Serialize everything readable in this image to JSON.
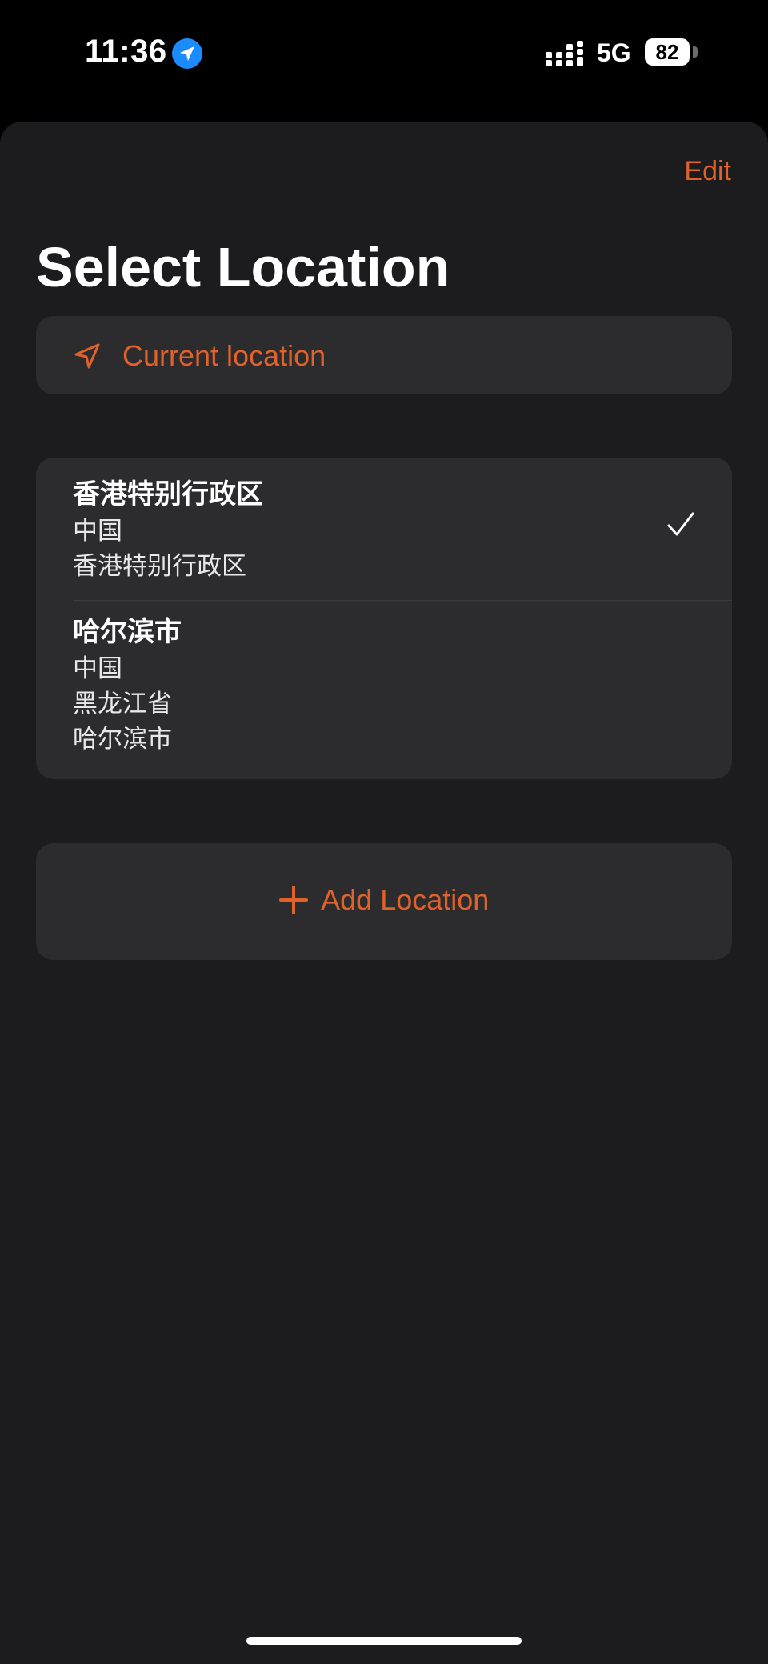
{
  "status_bar": {
    "time": "11:36",
    "network": "5G",
    "battery": "82",
    "icons": [
      "location-arrow-icon",
      "signal-icon",
      "battery-icon"
    ]
  },
  "header": {
    "edit_label": "Edit",
    "title": "Select Location"
  },
  "current_location": {
    "label": "Current location",
    "icon": "navigation-arrow-icon"
  },
  "locations": [
    {
      "name": "香港特别行政区",
      "lines": [
        "中国",
        "香港特别行政区"
      ],
      "selected": true
    },
    {
      "name": "哈尔滨市",
      "lines": [
        "中国",
        "黑龙江省",
        "哈尔滨市"
      ],
      "selected": false
    }
  ],
  "add_location": {
    "label": "Add Location",
    "icon": "plus-icon"
  },
  "colors": {
    "accent": "#e0622a",
    "sheet_background": "#1c1c1e",
    "card_background": "#2c2c2e",
    "status_location": "#1a8cff"
  }
}
